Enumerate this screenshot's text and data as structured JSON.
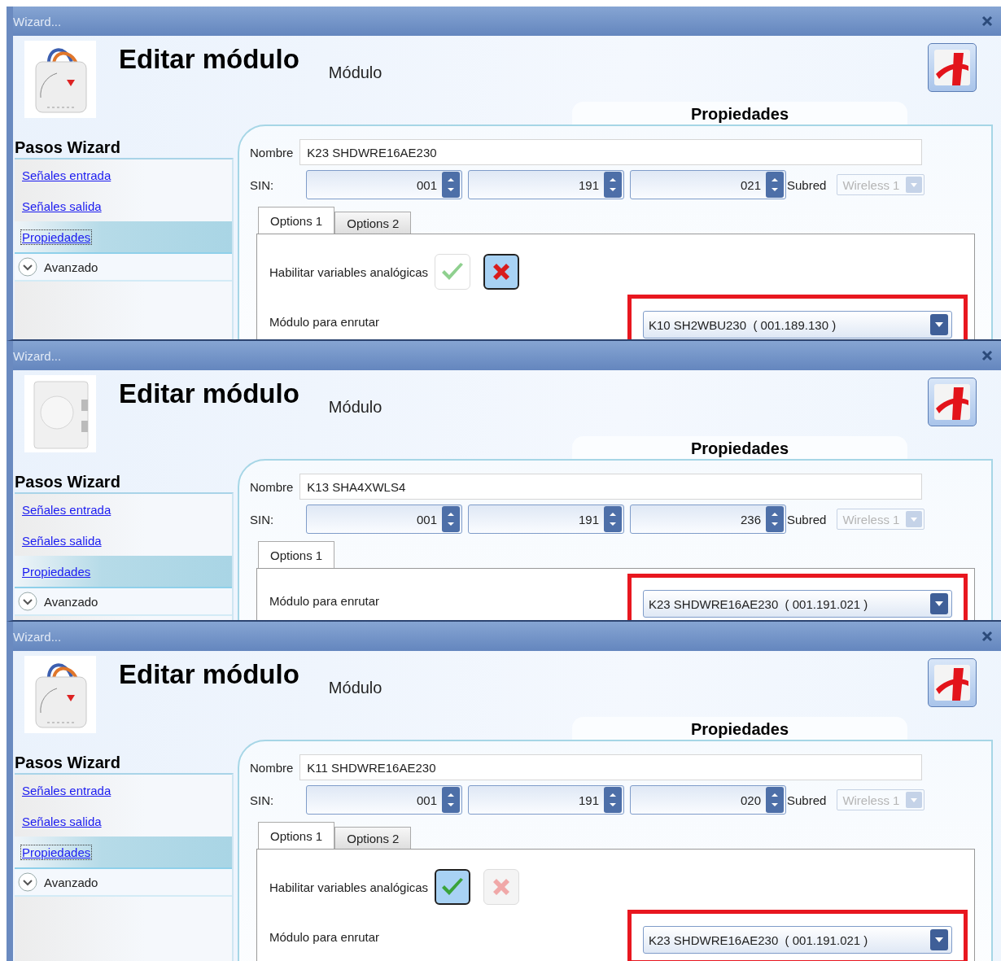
{
  "windows": [
    {
      "title": "Wizard...",
      "device": {
        "kind": "actuator"
      },
      "heading": "Editar módulo",
      "subheading": "Módulo",
      "steps_title": "Pasos Wizard",
      "steps": [
        {
          "label": "Señales entrada",
          "selected": false,
          "focused": false
        },
        {
          "label": "Señales salida",
          "selected": false,
          "focused": false
        },
        {
          "label": "Propiedades",
          "selected": true,
          "focused": true
        }
      ],
      "advanced": {
        "label": "Avanzado",
        "expanded": false
      },
      "section_title": "Propiedades",
      "name_label": "Nombre",
      "name_value": "K23 SHDWRE16AE230",
      "sin_label": "SIN:",
      "sin_values": [
        "001",
        "191",
        "021"
      ],
      "subnet_label": "Subred",
      "subnet_value": "Wireless 1",
      "subnet_disabled": true,
      "tabs": [
        {
          "label": "Options 1",
          "selected": true
        },
        {
          "label": "Options 2",
          "selected": false
        }
      ],
      "analog": {
        "label": "Habilitar variables analógicas",
        "enabled": false
      },
      "route": {
        "label": "Módulo para enrutar",
        "value": "K10 SH2WBU230  ( 001.189.130 )",
        "highlighted": true
      }
    },
    {
      "title": "Wizard...",
      "device": {
        "kind": "switch"
      },
      "heading": "Editar módulo",
      "subheading": "Módulo",
      "steps_title": "Pasos Wizard",
      "steps": [
        {
          "label": "Señales entrada",
          "selected": false,
          "focused": false
        },
        {
          "label": "Señales salida",
          "selected": false,
          "focused": false
        },
        {
          "label": "Propiedades",
          "selected": true,
          "focused": false
        }
      ],
      "advanced": {
        "label": "Avanzado",
        "expanded": false
      },
      "section_title": "Propiedades",
      "name_label": "Nombre",
      "name_value": "K13 SHA4XWLS4",
      "sin_label": "SIN:",
      "sin_values": [
        "001",
        "191",
        "236"
      ],
      "subnet_label": "Subred",
      "subnet_value": "Wireless 1",
      "subnet_disabled": true,
      "tabs": [
        {
          "label": "Options 1",
          "selected": true
        }
      ],
      "route": {
        "label": "Módulo para enrutar",
        "value": "K23 SHDWRE16AE230  ( 001.191.021 )",
        "highlighted": true
      }
    },
    {
      "title": "Wizard...",
      "device": {
        "kind": "actuator"
      },
      "heading": "Editar módulo",
      "subheading": "Módulo",
      "steps_title": "Pasos Wizard",
      "steps": [
        {
          "label": "Señales entrada",
          "selected": false,
          "focused": false
        },
        {
          "label": "Señales salida",
          "selected": false,
          "focused": false
        },
        {
          "label": "Propiedades",
          "selected": true,
          "focused": true
        }
      ],
      "advanced": {
        "label": "Avanzado",
        "expanded": false
      },
      "section_title": "Propiedades",
      "name_label": "Nombre",
      "name_value": "K11 SHDWRE16AE230",
      "sin_label": "SIN:",
      "sin_values": [
        "001",
        "191",
        "020"
      ],
      "subnet_label": "Subred",
      "subnet_value": "Wireless 1",
      "subnet_disabled": true,
      "tabs": [
        {
          "label": "Options 1",
          "selected": true
        },
        {
          "label": "Options 2",
          "selected": false
        }
      ],
      "analog": {
        "label": "Habilitar variables analógicas",
        "enabled": true
      },
      "route": {
        "label": "Módulo para enrutar",
        "value": "K23 SHDWRE16AE230  ( 001.191.021 )",
        "highlighted": true
      }
    }
  ]
}
